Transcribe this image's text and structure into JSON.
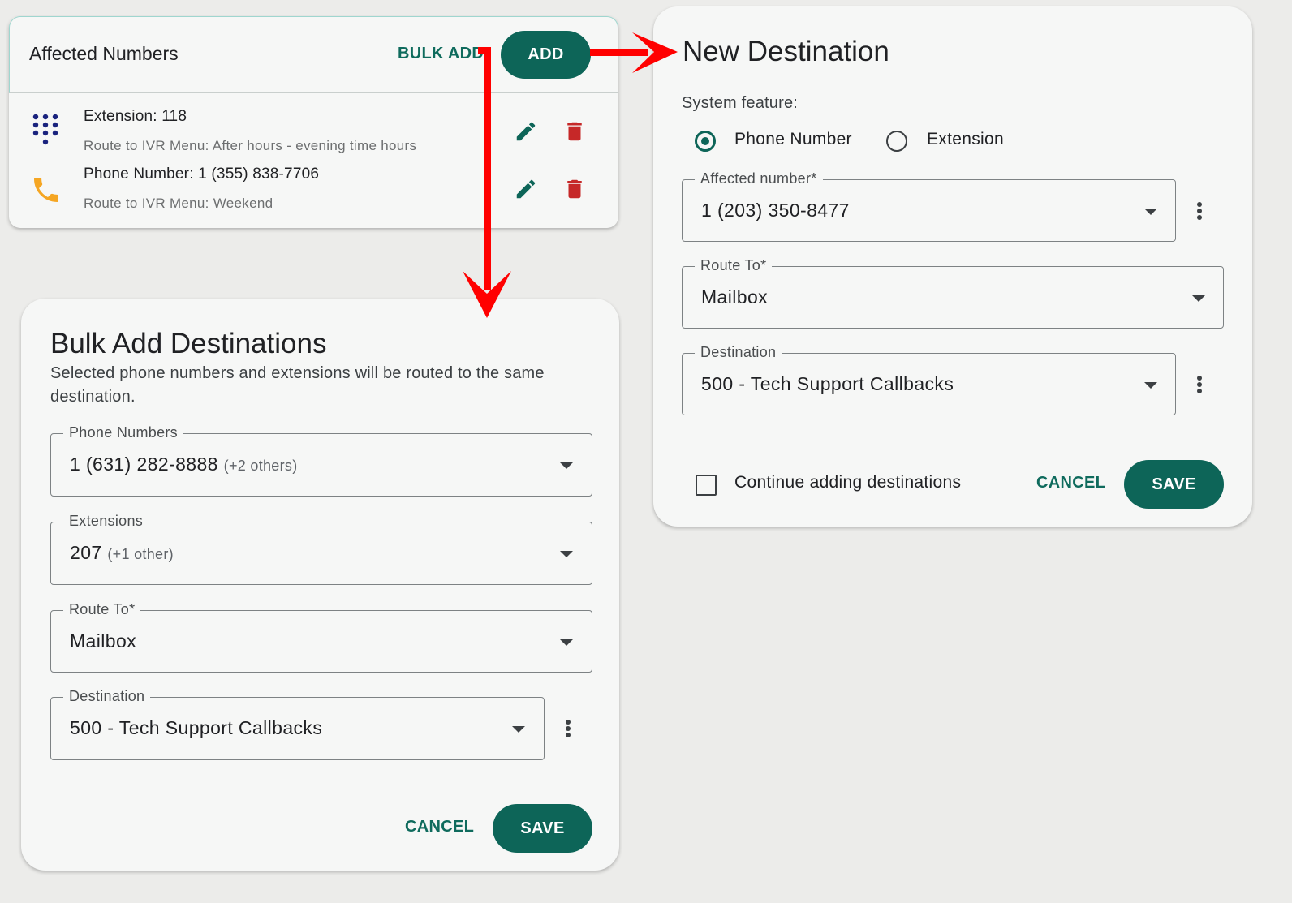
{
  "affected_card": {
    "title": "Affected Numbers",
    "bulk_add_label": "BULK ADD",
    "add_label": "ADD",
    "rows": [
      {
        "icon": "dialpad-icon",
        "title": "Extension: 118",
        "subtitle": "Route to IVR Menu: After hours - evening time hours"
      },
      {
        "icon": "phone-icon",
        "title": "Phone Number: 1 (355) 838-7706",
        "subtitle": "Route to IVR Menu: Weekend"
      }
    ]
  },
  "new_destination": {
    "title": "New Destination",
    "system_feature_label": "System feature:",
    "radio_options": [
      {
        "label": "Phone Number",
        "selected": true
      },
      {
        "label": "Extension",
        "selected": false
      }
    ],
    "affected_number": {
      "label": "Affected number*",
      "value": "1 (203) 350-8477"
    },
    "route_to": {
      "label": "Route To*",
      "value": "Mailbox"
    },
    "destination": {
      "label": "Destination",
      "value": "500 - Tech Support Callbacks"
    },
    "continue_label": "Continue adding destinations",
    "continue_checked": false,
    "cancel_label": "CANCEL",
    "save_label": "SAVE"
  },
  "bulk_add": {
    "title": "Bulk Add Destinations",
    "description": "Selected phone numbers and extensions will be routed to the same destination.",
    "phone_numbers": {
      "label": "Phone Numbers",
      "value": "1 (631) 282-8888",
      "extra": "(+2 others)"
    },
    "extensions": {
      "label": "Extensions",
      "value": "207",
      "extra": "(+1 other)"
    },
    "route_to": {
      "label": "Route To*",
      "value": "Mailbox"
    },
    "destination": {
      "label": "Destination",
      "value": "500 - Tech Support Callbacks"
    },
    "cancel_label": "CANCEL",
    "save_label": "SAVE"
  },
  "colors": {
    "primary": "#0d6558",
    "delete": "#c62828",
    "phone_icon": "#f5a623",
    "dialpad_icon": "#1a237e",
    "annotation_arrow": "#ff0000"
  }
}
